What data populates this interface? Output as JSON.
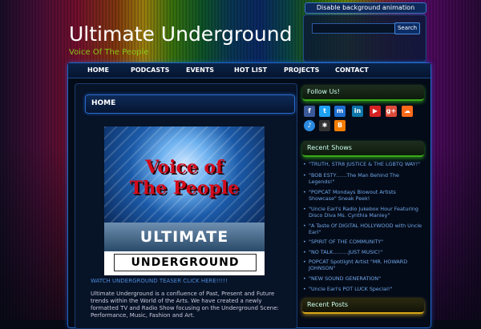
{
  "header": {
    "disable_animation": "Disable background animation",
    "site_title": "Ultimate Underground",
    "site_description": "Voice Of The People",
    "search_button": "Search"
  },
  "nav": [
    "HOME",
    "PODCASTS",
    "EVENTS",
    "HOT LIST",
    "PROJECTS",
    "CONTACT"
  ],
  "main": {
    "heading": "HOME",
    "poster": {
      "line1": "Voice of",
      "line2": "The People",
      "line3": "ULTIMATE",
      "line4": "UNDERGROUND"
    },
    "teaser_link": "WATCH UNDERGROUND TEASER CLICK HERE!!!!!",
    "intro": "Ultimate Underground is a confluence of Past, Present and Future trends within the World of the Arts. We have created a newly formatted TV and Radio Show focusing on the Underground Scene: Performance, Music, Fashion and Art."
  },
  "sidebar": {
    "follow_title": "Follow Us!",
    "social_icons": [
      "facebook-icon",
      "twitter-icon",
      "myspace-icon",
      "linkedin-icon",
      "youtube-icon",
      "google-plus-icon",
      "soundcloud-icon",
      "itunes-icon",
      "reverbnation-icon",
      "blogger-icon"
    ],
    "recent_shows_title": "Recent Shows",
    "recent_shows": [
      "\"TRUTH, STR8 JUSTICE & THE LGBTQ WAY!\"",
      "\"BOB ESTY……The Man Behind The Legends!\"",
      "\"POPCAT Mondays Blowout Artists Showcase\" Sneak Peek!",
      "\"Uncle Earl's Radio Jukebox Hour Featuring Disco Diva Ms. Cynthia Manley\"",
      "\"A Taste Of DIGITAL HOLLYWOOD with Uncle Earl\"",
      "\"SPIRIT OF THE COMMUNITY\"",
      "\"NO TALK………JUST MUSIC!\"",
      "POPCAT Spotlight Artist \"MR. HOWARD JOHNSON\"",
      "\"NEW SOUND GENERATION\"",
      "\"Uncle Earl's POT LUCK Special!\""
    ],
    "recent_posts_title": "Recent Posts"
  },
  "colors": {
    "accent": "#1e66c8",
    "tagline": "#8ac41a",
    "link": "#6fa6e8"
  }
}
